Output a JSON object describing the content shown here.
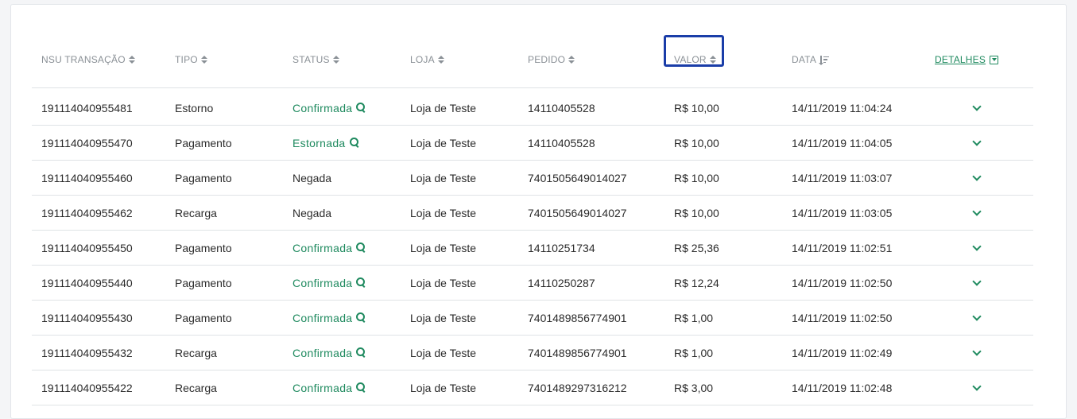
{
  "table": {
    "columns": {
      "nsu": "NSU TRANSAÇÃO",
      "tipo": "TIPO",
      "status": "STATUS",
      "loja": "LOJA",
      "pedido": "PEDIDO",
      "valor": "VALOR",
      "data": "DATA",
      "detalhes": "DETALHES"
    },
    "rows": [
      {
        "nsu": "191114040955481",
        "tipo": "Estorno",
        "status": "Confirmada",
        "status_link": true,
        "loja": "Loja de Teste",
        "pedido": "14110405528",
        "valor": "R$ 10,00",
        "data": "14/11/2019 11:04:24"
      },
      {
        "nsu": "191114040955470",
        "tipo": "Pagamento",
        "status": "Estornada",
        "status_link": true,
        "loja": "Loja de Teste",
        "pedido": "14110405528",
        "valor": "R$ 10,00",
        "data": "14/11/2019 11:04:05"
      },
      {
        "nsu": "191114040955460",
        "tipo": "Pagamento",
        "status": "Negada",
        "status_link": false,
        "loja": "Loja de Teste",
        "pedido": "7401505649014027",
        "valor": "R$ 10,00",
        "data": "14/11/2019 11:03:07"
      },
      {
        "nsu": "191114040955462",
        "tipo": "Recarga",
        "status": "Negada",
        "status_link": false,
        "loja": "Loja de Teste",
        "pedido": "7401505649014027",
        "valor": "R$ 10,00",
        "data": "14/11/2019 11:03:05"
      },
      {
        "nsu": "191114040955450",
        "tipo": "Pagamento",
        "status": "Confirmada",
        "status_link": true,
        "loja": "Loja de Teste",
        "pedido": "14110251734",
        "valor": "R$ 25,36",
        "data": "14/11/2019 11:02:51"
      },
      {
        "nsu": "191114040955440",
        "tipo": "Pagamento",
        "status": "Confirmada",
        "status_link": true,
        "loja": "Loja de Teste",
        "pedido": "14110250287",
        "valor": "R$ 12,24",
        "data": "14/11/2019 11:02:50"
      },
      {
        "nsu": "191114040955430",
        "tipo": "Pagamento",
        "status": "Confirmada",
        "status_link": true,
        "loja": "Loja de Teste",
        "pedido": "7401489856774901",
        "valor": "R$ 1,00",
        "data": "14/11/2019 11:02:50"
      },
      {
        "nsu": "191114040955432",
        "tipo": "Recarga",
        "status": "Confirmada",
        "status_link": true,
        "loja": "Loja de Teste",
        "pedido": "7401489856774901",
        "valor": "R$ 1,00",
        "data": "14/11/2019 11:02:49"
      },
      {
        "nsu": "191114040955422",
        "tipo": "Recarga",
        "status": "Confirmada",
        "status_link": true,
        "loja": "Loja de Teste",
        "pedido": "7401489297316212",
        "valor": "R$ 3,00",
        "data": "14/11/2019 11:02:48"
      }
    ]
  },
  "colors": {
    "accent_green": "#1f8a5f",
    "highlight_border": "#1a3da8",
    "header_text": "#8a9096"
  },
  "icons": {
    "sort": "sort-icon",
    "sort_desc": "sort-desc-icon",
    "status_search": "search-icon",
    "row_expand": "chevron-down-icon",
    "detalhes": "caret-box-icon"
  }
}
